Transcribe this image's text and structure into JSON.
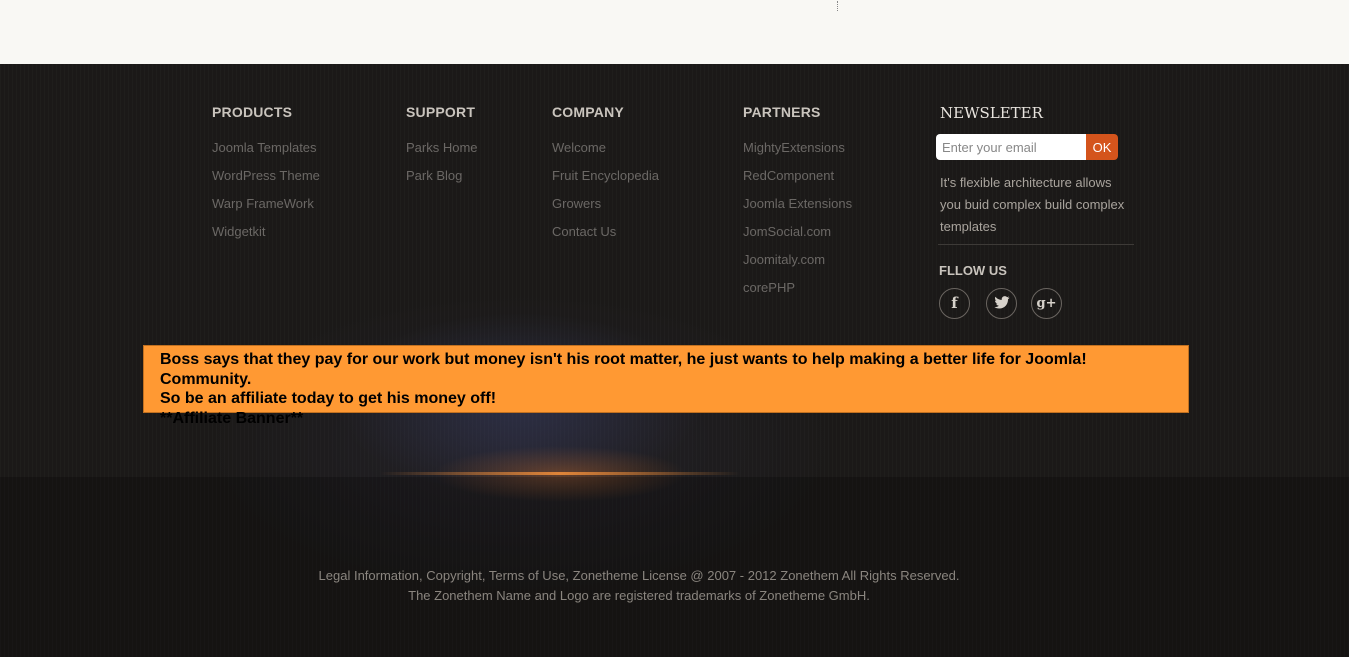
{
  "footer": {
    "columns": [
      {
        "heading": "PRODUCTS",
        "items": [
          "Joomla Templates",
          "WordPress Theme",
          "Warp FrameWork",
          "Widgetkit"
        ]
      },
      {
        "heading": "SUPPORT",
        "items": [
          "Parks Home",
          "Park Blog"
        ]
      },
      {
        "heading": "COMPANY",
        "items": [
          "Welcome",
          "Fruit Encyclopedia",
          "Growers",
          "Contact Us"
        ]
      },
      {
        "heading": "PARTNERS",
        "items": [
          "MightyExtensions",
          "RedComponent",
          "Joomla Extensions",
          "JomSocial.com",
          "Joomitaly.com",
          "corePHP"
        ]
      }
    ],
    "newsletter": {
      "heading": "NEWSLETER",
      "placeholder": "Enter your email",
      "button_label": "OK",
      "description": "It's flexible architecture allows you buid complex build complex templates"
    },
    "follow": {
      "heading": "FLLOW US",
      "icons": [
        "facebook-icon",
        "twitter-icon",
        "google-plus-icon"
      ],
      "glyphs": {
        "facebook": "f",
        "google_plus": "g+"
      }
    },
    "affiliate": {
      "line1": "Boss says that they pay for our work but money isn't his root matter, he just wants to help making a better life for Joomla! Community.",
      "line2": "So be an affiliate today to get his money off!",
      "line3": "**Affiliate Banner**"
    },
    "legal": {
      "line1": "Legal Information, Copyright, Terms of Use, Zonetheme License @ 2007 - 2012 Zonethem All Rights Reserved.",
      "line2": "The Zonethem Name and Logo are registered trademarks of Zonetheme GmbH."
    }
  },
  "colors": {
    "accent_button": "#d4541c",
    "affiliate_bg": "#ff9933",
    "footer_bg": "#1b1918",
    "top_bg": "#f9f8f4"
  }
}
